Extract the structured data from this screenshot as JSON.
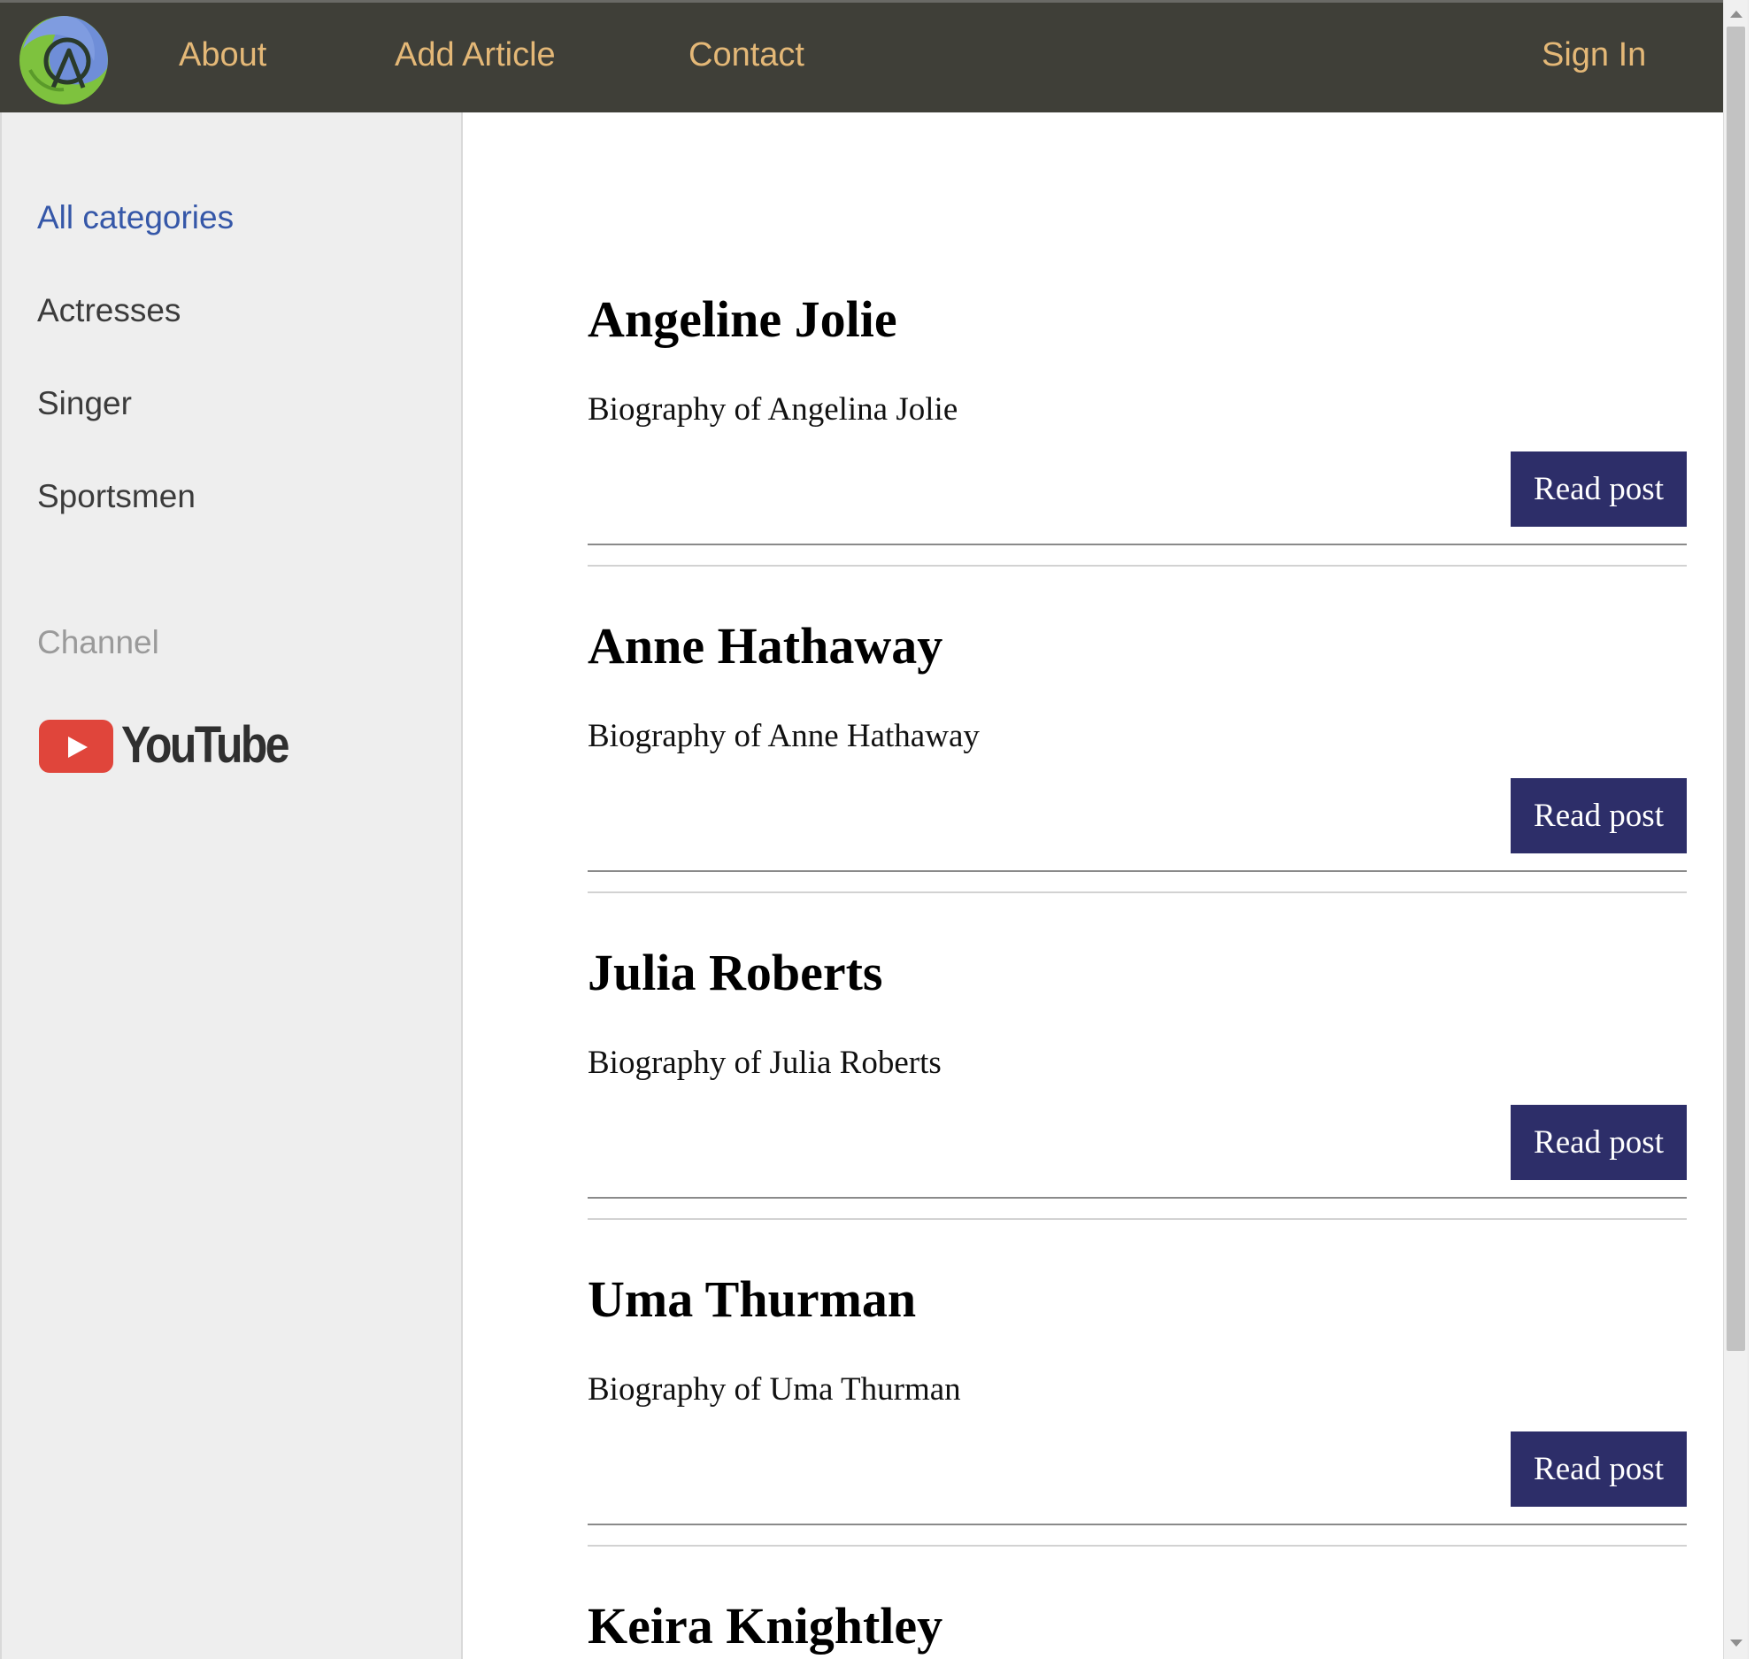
{
  "nav": {
    "about": "About",
    "add_article": "Add Article",
    "contact": "Contact",
    "sign_in": "Sign In"
  },
  "sidebar": {
    "categories": [
      "All categories",
      "Actresses",
      "Singer",
      "Sportsmen"
    ],
    "active_category": "All categories",
    "channel_label": "Channel",
    "youtube_text": "YouTube"
  },
  "articles": [
    {
      "title": "Angeline Jolie",
      "description": "Biography of Angelina Jolie",
      "button": "Read post"
    },
    {
      "title": "Anne Hathaway",
      "description": "Biography of Anne Hathaway",
      "button": "Read post"
    },
    {
      "title": "Julia Roberts",
      "description": "Biography of Julia Roberts",
      "button": "Read post"
    },
    {
      "title": "Uma Thurman",
      "description": "Biography of Uma Thurman",
      "button": "Read post"
    },
    {
      "title": "Keira Knightley"
    }
  ],
  "colors": {
    "topbar": "#3f3f38",
    "nav_link": "#e4b877",
    "sidebar_bg": "#eeeeee",
    "active_category": "#3557a8",
    "button_bg": "#2d2e69",
    "youtube_red": "#e0453b"
  },
  "icons": {
    "logo": "app-logo-icon",
    "youtube": "youtube-logo-icon"
  }
}
